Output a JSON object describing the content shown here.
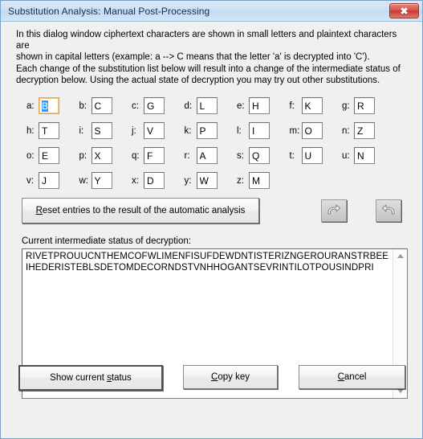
{
  "window": {
    "title": "Substitution Analysis: Manual Post-Processing",
    "close_icon": "close-icon",
    "close_glyph": "✖",
    "accent_title_color": "#cfe2f4",
    "close_button_color": "#c8382c"
  },
  "description": {
    "line1": "In this dialog window ciphertext characters are shown in small letters and plaintext characters are",
    "line2": "shown in capital letters (example: a --> C means that the letter 'a' is decrypted into 'C').",
    "line3": "Each change of the substitution list below will result into a change of the intermediate status of",
    "line4": "decryption below. Using the actual state of decryption you may try out other substitutions."
  },
  "substitutions": {
    "rows": [
      [
        {
          "label": "a:",
          "value": "B",
          "selected": true
        },
        {
          "label": "b:",
          "value": "C",
          "selected": false
        },
        {
          "label": "c:",
          "value": "G",
          "selected": false
        },
        {
          "label": "d:",
          "value": "L",
          "selected": false
        },
        {
          "label": "e:",
          "value": "H",
          "selected": false
        },
        {
          "label": "f:",
          "value": "K",
          "selected": false
        },
        {
          "label": "g:",
          "value": "R",
          "selected": false
        }
      ],
      [
        {
          "label": "h:",
          "value": "T",
          "selected": false
        },
        {
          "label": "i:",
          "value": "S",
          "selected": false
        },
        {
          "label": "j:",
          "value": "V",
          "selected": false
        },
        {
          "label": "k:",
          "value": "P",
          "selected": false
        },
        {
          "label": "l:",
          "value": "I",
          "selected": false
        },
        {
          "label": "m:",
          "value": "O",
          "selected": false
        },
        {
          "label": "n:",
          "value": "Z",
          "selected": false
        }
      ],
      [
        {
          "label": "o:",
          "value": "E",
          "selected": false
        },
        {
          "label": "p:",
          "value": "X",
          "selected": false
        },
        {
          "label": "q:",
          "value": "F",
          "selected": false
        },
        {
          "label": "r:",
          "value": "A",
          "selected": false
        },
        {
          "label": "s:",
          "value": "Q",
          "selected": false
        },
        {
          "label": "t:",
          "value": "U",
          "selected": false
        },
        {
          "label": "u:",
          "value": "N",
          "selected": false
        }
      ],
      [
        {
          "label": "v:",
          "value": "J",
          "selected": false
        },
        {
          "label": "w:",
          "value": "Y",
          "selected": false
        },
        {
          "label": "x:",
          "value": "D",
          "selected": false
        },
        {
          "label": "y:",
          "value": "W",
          "selected": false
        },
        {
          "label": "z:",
          "value": "M",
          "selected": false
        }
      ]
    ]
  },
  "reset_button": {
    "accel": "R",
    "rest": "eset entries to the result of the automatic analysis"
  },
  "undo_redo": {
    "undo_icon": "undo-arrow-icon",
    "redo_icon": "redo-arrow-icon",
    "disabled": true
  },
  "status_section": {
    "label": "Current intermediate status of decryption:",
    "text": "RIVETPROUUCNTHEMCOFWLIMENFISUFDEWDNTISTERIZNGEROURANSTRBEEIHEDERISTEBLSDETOMDECORNDSTVNHHOGANTSEVRINTILOTPOUSINDPRI",
    "scrollbar": {
      "up_icon": "scroll-up-arrow-icon",
      "down_icon": "scroll-down-arrow-icon"
    }
  },
  "bottom_buttons": {
    "show_status": {
      "pre": "Show current ",
      "accel": "s",
      "post": "tatus"
    },
    "copy_key": {
      "accel": "C",
      "rest": "opy key"
    },
    "cancel": {
      "accel": "C",
      "rest": "ancel"
    }
  }
}
